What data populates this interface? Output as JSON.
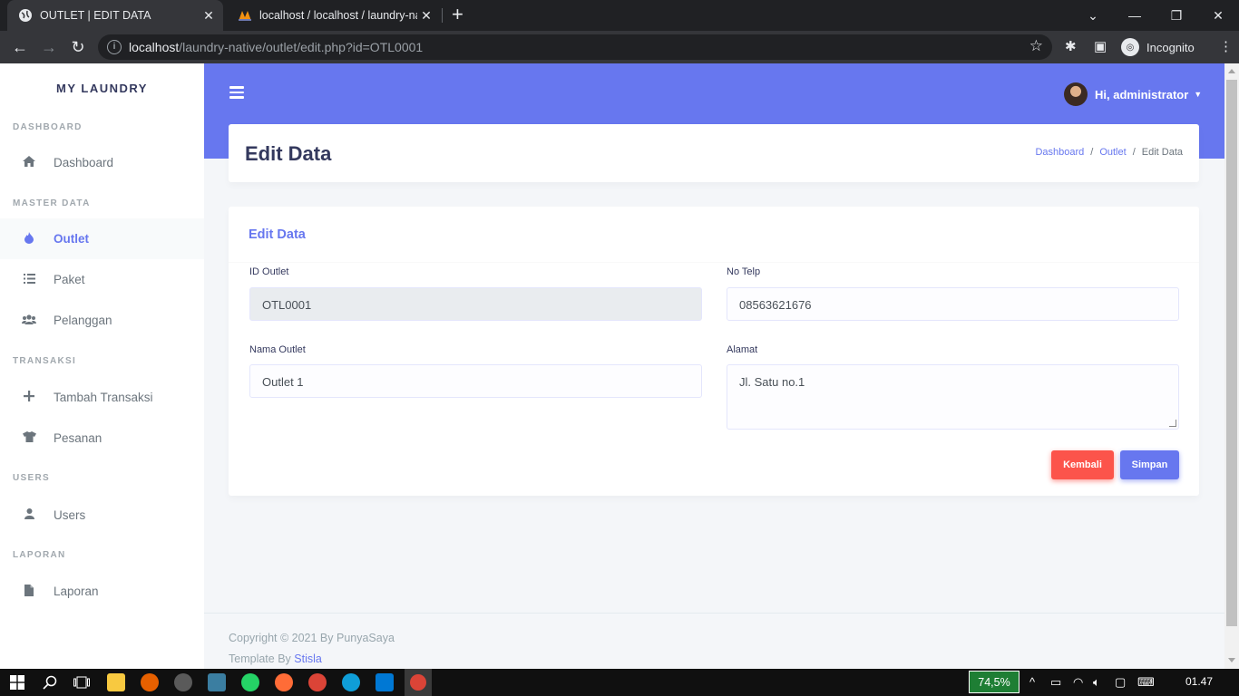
{
  "browser": {
    "tabs": [
      {
        "title": "OUTLET | EDIT DATA"
      },
      {
        "title": "localhost / localhost / laundry-na"
      }
    ],
    "url_host": "localhost",
    "url_path": "/laundry-native/outlet/edit.php?id=OTL0001",
    "profile_label": "Incognito"
  },
  "sidebar": {
    "brand": "MY LAUNDRY",
    "headers": [
      "DASHBOARD",
      "MASTER DATA",
      "TRANSAKSI",
      "USERS",
      "LAPORAN"
    ],
    "items": [
      {
        "label": "Dashboard",
        "icon": "home-icon"
      },
      {
        "label": "Outlet",
        "icon": "fire-icon",
        "active": true
      },
      {
        "label": "Paket",
        "icon": "list-icon"
      },
      {
        "label": "Pelanggan",
        "icon": "users-icon"
      },
      {
        "label": "Tambah Transaksi",
        "icon": "plus-icon"
      },
      {
        "label": "Pesanan",
        "icon": "tshirt-icon"
      },
      {
        "label": "Users",
        "icon": "user-icon"
      },
      {
        "label": "Laporan",
        "icon": "file-icon"
      }
    ]
  },
  "navbar": {
    "greeting": "Hi, administrator"
  },
  "header": {
    "title": "Edit Data",
    "breadcrumb": [
      "Dashboard",
      "Outlet",
      "Edit Data"
    ],
    "separator": "/"
  },
  "form": {
    "card_title": "Edit Data",
    "id_outlet": {
      "label": "ID Outlet",
      "value": "OTL0001"
    },
    "no_telp": {
      "label": "No Telp",
      "value": "08563621676"
    },
    "nama_outlet": {
      "label": "Nama Outlet",
      "value": "Outlet 1"
    },
    "alamat": {
      "label": "Alamat",
      "value": "Jl. Satu no.1"
    },
    "back_button": "Kembali",
    "save_button": "Simpan"
  },
  "footer": {
    "copyright": "Copyright © 2021 By PunyaSaya",
    "template_prefix": "Template By ",
    "template_link": "Stisla"
  },
  "taskbar": {
    "battery": "74,5%",
    "time": "01.47"
  },
  "colors": {
    "primary": "#6777ef",
    "danger": "#fc544b"
  }
}
